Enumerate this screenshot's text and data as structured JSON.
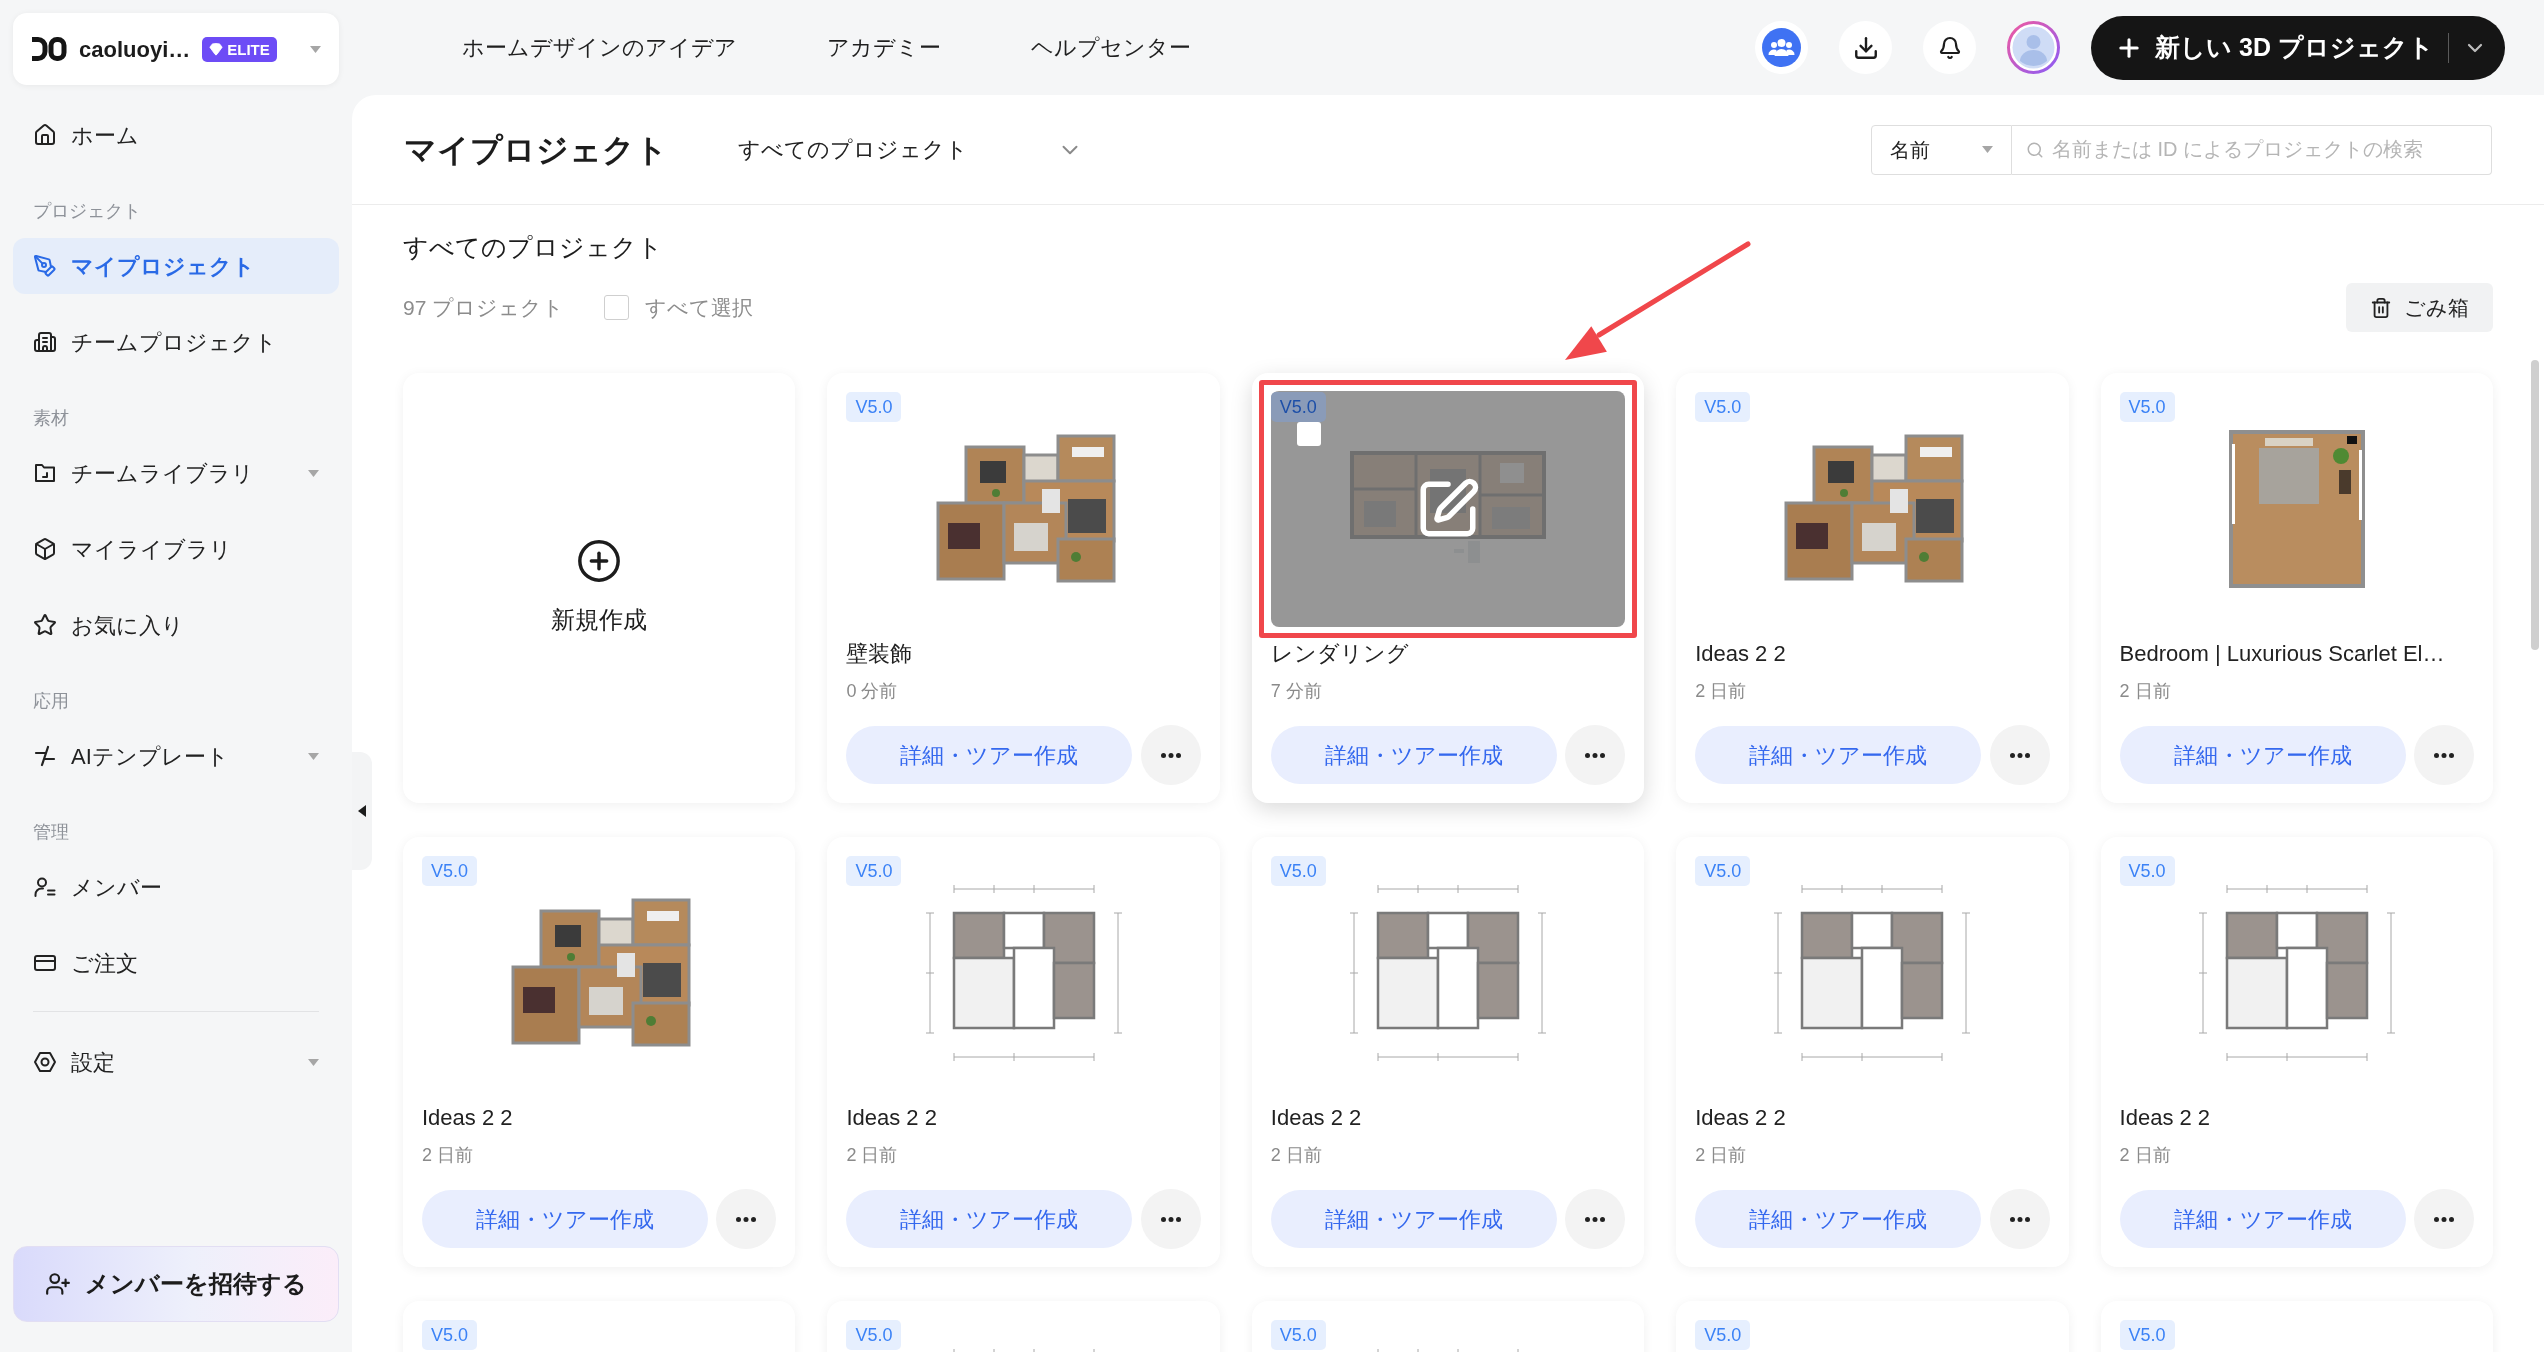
{
  "account": {
    "name": "caoluoyi…",
    "badge": "ELITE"
  },
  "sidebar": {
    "sections": [
      {
        "items": [
          {
            "label": "ホーム",
            "selected": false,
            "submenu": false
          }
        ]
      },
      {
        "title": "プロジェクト",
        "items": [
          {
            "label": "マイプロジェクト",
            "selected": true,
            "submenu": false
          },
          {
            "label": "チームプロジェクト",
            "selected": false,
            "submenu": false
          }
        ]
      },
      {
        "title": "素材",
        "items": [
          {
            "label": "チームライブラリ",
            "selected": false,
            "submenu": true
          },
          {
            "label": "マイライブラリ",
            "selected": false,
            "submenu": false
          },
          {
            "label": "お気に入り",
            "selected": false,
            "submenu": false
          }
        ]
      },
      {
        "title": "応用",
        "items": [
          {
            "label": "AIテンプレート",
            "selected": false,
            "submenu": true
          }
        ]
      },
      {
        "title": "管理",
        "items": [
          {
            "label": "メンバー",
            "selected": false,
            "submenu": false
          },
          {
            "label": "ご注文",
            "selected": false,
            "submenu": false
          }
        ]
      },
      {
        "items": [
          {
            "label": "設定",
            "selected": false,
            "submenu": true
          }
        ]
      }
    ],
    "invite_button": "メンバーを招待する"
  },
  "top_nav": {
    "links": [
      "ホームデザインのアイデア",
      "アカデミー",
      "ヘルプセンター"
    ],
    "new_project_button": "新しい 3D プロジェクト"
  },
  "header": {
    "title": "マイプロジェクト",
    "filter": "すべてのプロジェクト",
    "sort": "名前",
    "search": {
      "placeholder": "名前または ID によるプロジェクトの検索"
    }
  },
  "projects": {
    "title": "すべてのプロジェクト",
    "count": "97 プロジェクト",
    "select_all": {
      "label": "すべて選択",
      "checked": false
    },
    "trash_button": "ごみ箱",
    "cards": [
      {
        "kind": "new",
        "label": "新規作成"
      },
      {
        "kind": "project",
        "version": "V5.0",
        "thumbnail": {
          "kind": "rendered"
        },
        "title": "壁装飾",
        "time": "0 分前",
        "action": "詳細・ツアー作成",
        "hovered": false,
        "checked": false,
        "highlighted": false
      },
      {
        "kind": "project",
        "version": "V5.0",
        "thumbnail": {
          "kind": "strip"
        },
        "title": "レンダリング",
        "time": "7 分前",
        "action": "詳細・ツアー作成",
        "hovered": true,
        "checked": false,
        "highlighted": true
      },
      {
        "kind": "project",
        "version": "V5.0",
        "thumbnail": {
          "kind": "rendered"
        },
        "title": "Ideas 2 2",
        "time": "2 日前",
        "action": "詳細・ツアー作成",
        "hovered": false,
        "checked": false,
        "highlighted": false
      },
      {
        "kind": "project",
        "version": "V5.0",
        "thumbnail": {
          "kind": "room"
        },
        "title": "Bedroom | Luxurious Scarlet El…",
        "time": "2 日前",
        "action": "詳細・ツアー作成",
        "hovered": false,
        "checked": false,
        "highlighted": false
      },
      {
        "kind": "project",
        "version": "V5.0",
        "thumbnail": {
          "kind": "rendered"
        },
        "title": "Ideas 2 2",
        "time": "2 日前",
        "action": "詳細・ツアー作成",
        "hovered": false,
        "checked": false,
        "highlighted": false
      },
      {
        "kind": "project",
        "version": "V5.0",
        "thumbnail": {
          "kind": "blueprint"
        },
        "title": "Ideas 2 2",
        "time": "2 日前",
        "action": "詳細・ツアー作成",
        "hovered": false,
        "checked": false,
        "highlighted": false
      },
      {
        "kind": "project",
        "version": "V5.0",
        "thumbnail": {
          "kind": "blueprint"
        },
        "title": "Ideas 2 2",
        "time": "2 日前",
        "action": "詳細・ツアー作成",
        "hovered": false,
        "checked": false,
        "highlighted": false
      },
      {
        "kind": "project",
        "version": "V5.0",
        "thumbnail": {
          "kind": "blueprint"
        },
        "title": "Ideas 2 2",
        "time": "2 日前",
        "action": "詳細・ツアー作成",
        "hovered": false,
        "checked": false,
        "highlighted": false
      },
      {
        "kind": "project",
        "version": "V5.0",
        "thumbnail": {
          "kind": "blueprint"
        },
        "title": "Ideas 2 2",
        "time": "2 日前",
        "action": "詳細・ツアー作成",
        "hovered": false,
        "checked": false,
        "highlighted": false
      },
      {
        "kind": "project",
        "version": "V5.0",
        "hovered": false,
        "checked": false,
        "highlighted": false
      },
      {
        "kind": "project",
        "version": "V5.0",
        "thumbnail": {
          "kind": "blueprint"
        },
        "hovered": false,
        "checked": false,
        "highlighted": false
      },
      {
        "kind": "project",
        "version": "V5.0",
        "thumbnail": {
          "kind": "blueprint"
        },
        "hovered": false,
        "checked": false,
        "highlighted": false
      },
      {
        "kind": "project",
        "version": "V5.0",
        "hovered": false,
        "checked": false,
        "highlighted": false
      },
      {
        "kind": "project",
        "version": "V5.0",
        "hovered": false,
        "checked": false,
        "highlighted": false
      }
    ]
  }
}
